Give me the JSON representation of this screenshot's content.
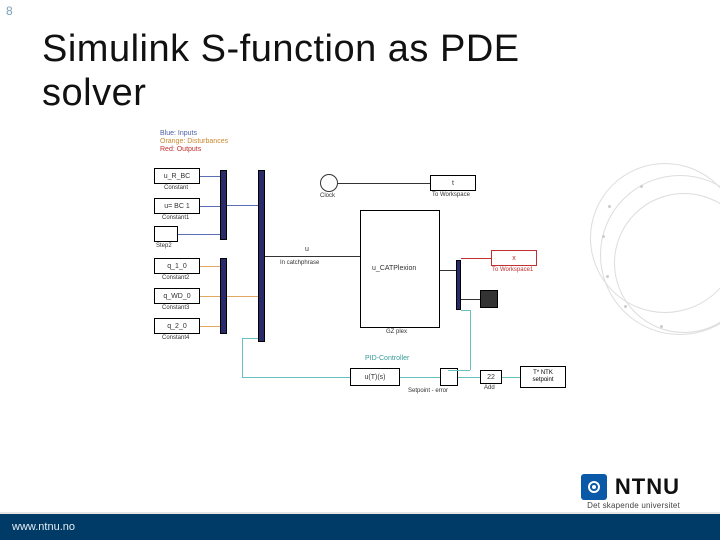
{
  "page_number": "8",
  "title_line1": "Simulink S-function as PDE",
  "title_line2": "solver",
  "diagram": {
    "legend1": "Blue: Inputs",
    "legend2": "Orange: Disturbances",
    "legend3": "Red: Outputs",
    "blocks": {
      "constant_R_BC": "u_R_BC",
      "constant_label1": "Constant",
      "constant_BC1": "u= BC 1",
      "constant_label2": "Constant1",
      "step_label": "Step2",
      "q1": "q_1_0",
      "constant_label3": "Constant2",
      "q2": "q_WD_0",
      "constant_label4": "Constant3",
      "q3": "q_2_0",
      "constant_label5": "Constant4",
      "clock": "Clock",
      "to_workspace_t": "t",
      "to_workspace_lbl1": "To Workspace",
      "mux_in_lbl": "u",
      "in_catchphrase": "In catchphrase",
      "sfn_lbl": "u_CATPlexion",
      "gz_lbl": "GZ plex",
      "to_workspace_x": "x",
      "to_workspace_lbl2": "To Workspace1",
      "pid_lbl": "PID-Controller",
      "pid_block": "u(T)(s)",
      "setpoint_lbl": "Setpoint - error",
      "setpoint_val": "22",
      "add_lbl": "Add",
      "sp_block_l1": "T* NTK",
      "sp_block_l2": "setpoint"
    }
  },
  "logo_text": "NTNU",
  "tagline": "Det skapende universitet",
  "footer_url": "www.ntnu.no"
}
